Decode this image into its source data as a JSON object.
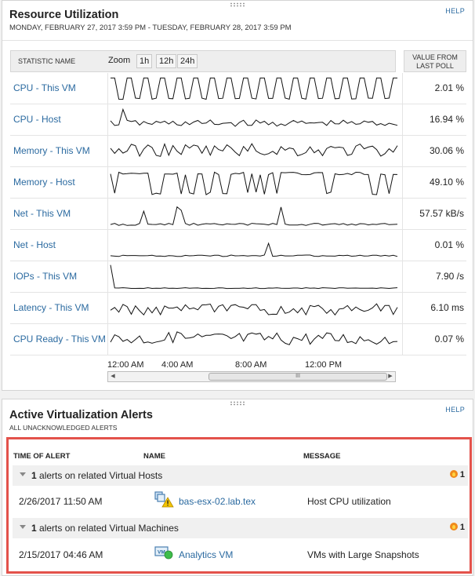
{
  "resource": {
    "title": "Resource Utilization",
    "date_range": "MONDAY, FEBRUARY 27, 2017 3:59 PM - TUESDAY, FEBRUARY 28, 2017 3:59 PM",
    "help": "HELP",
    "col_stat": "STATISTIC NAME",
    "zoom_label": "Zoom",
    "zoom_buttons": [
      "1h",
      "12h",
      "24h"
    ],
    "col_value_1": "VALUE FROM",
    "col_value_2": "LAST POLL",
    "rows": [
      {
        "name": "CPU - This VM",
        "value": "2.01 %"
      },
      {
        "name": "CPU - Host",
        "value": "16.94 %"
      },
      {
        "name": "Memory - This VM",
        "value": "30.06 %"
      },
      {
        "name": "Memory - Host",
        "value": "49.10 %"
      },
      {
        "name": "Net - This VM",
        "value": "57.57 kB/s"
      },
      {
        "name": "Net - Host",
        "value": "0.01 %"
      },
      {
        "name": "IOPs - This VM",
        "value": "7.90 /s"
      },
      {
        "name": "Latency - This VM",
        "value": "6.10 ms"
      },
      {
        "name": "CPU Ready - This VM",
        "value": "0.07 %"
      }
    ],
    "x_ticks": [
      "12:00 AM",
      "4:00 AM",
      "8:00 AM",
      "12:00 PM"
    ],
    "scroll_thumb_glyph": "III"
  },
  "alerts": {
    "title": "Active Virtualization Alerts",
    "subtitle": "ALL UNACKNOWLEDGED ALERTS",
    "help": "HELP",
    "col_time": "TIME OF ALERT",
    "col_name": "NAME",
    "col_message": "MESSAGE",
    "groups": [
      {
        "count": "1",
        "label": " alerts on related Virtual Hosts",
        "badge": "1",
        "alert": {
          "time": "2/26/2017 11:50 AM",
          "entity": "bas-esx-02.lab.tex",
          "message": "Host CPU utilization",
          "icon": "host-warning-icon"
        }
      },
      {
        "count": "1",
        "label": " alerts on related Virtual Machines",
        "badge": "1",
        "alert": {
          "time": "2/15/2017 04:46 AM",
          "entity": "Analytics VM",
          "message": "VMs with Large Snapshots",
          "icon": "vm-up-icon"
        }
      }
    ]
  },
  "colors": {
    "link": "#2b6aa0",
    "highlight_border": "#e3524b",
    "alert_flame": "#f08a1c"
  }
}
